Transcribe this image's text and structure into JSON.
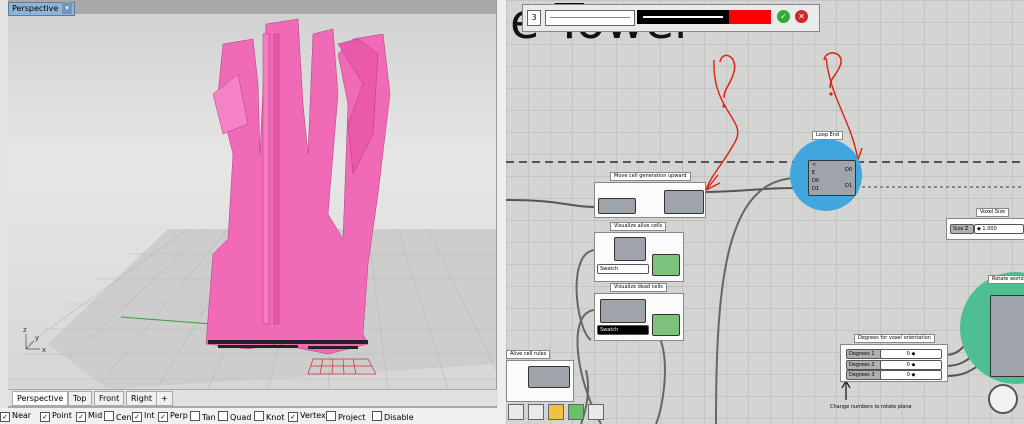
{
  "rhino": {
    "viewport_title": "Perspective",
    "view_tabs": [
      "Perspective",
      "Top",
      "Front",
      "Right"
    ],
    "add_tab": "+",
    "osnaps": [
      {
        "label": "Near",
        "checked": true
      },
      {
        "label": "Point",
        "checked": true
      },
      {
        "label": "Mid",
        "checked": true
      },
      {
        "label": "Cen",
        "checked": false
      },
      {
        "label": "Int",
        "checked": true
      },
      {
        "label": "Perp",
        "checked": true
      },
      {
        "label": "Tan",
        "checked": false
      },
      {
        "label": "Quad",
        "checked": false
      },
      {
        "label": "Knot",
        "checked": false
      },
      {
        "label": "Vertex",
        "checked": true
      },
      {
        "label": "Project",
        "checked": false
      },
      {
        "label": "Disable",
        "checked": false
      }
    ],
    "axis_labels": {
      "x": "x",
      "y": "y",
      "z": "z"
    },
    "model_color": "#f06ab5"
  },
  "grasshopper": {
    "title_fragment": "e Tower",
    "slider_value": "3",
    "slider_color": "#ff0000",
    "groups": {
      "move": "Move cell generation upward",
      "alive_vis": "Visualize alive cells",
      "dead_vis": "Visualize dead cells",
      "alive_rules": "Alive cell rules",
      "loop_end": "Loop End",
      "voxel_size": "Voxel Size",
      "rotate_world": "Rotate world",
      "degrees": "Degrees for voxel orientation"
    },
    "voxel_size_value": "Size Z",
    "voxel_size_number": "◆ 1.000",
    "degree_sliders": [
      {
        "label": "Degrees 1",
        "value": "0 ◆"
      },
      {
        "label": "Degrees 2",
        "value": "0 ◆"
      },
      {
        "label": "Degrees 3",
        "value": "0 ◆"
      }
    ],
    "swatch_label": "Swatch",
    "change_note": "Change numbers to rotate plane",
    "annotation_marks": [
      "?",
      "?"
    ],
    "loop_ports_in": [
      "<",
      "E",
      "D0",
      "D1"
    ],
    "loop_ports_out": [
      "D0",
      "D1"
    ]
  }
}
